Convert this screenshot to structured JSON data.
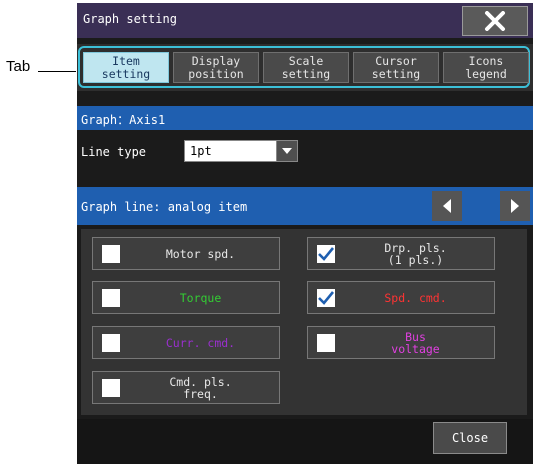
{
  "callout": {
    "label": "Tab"
  },
  "dialog": {
    "title": "Graph setting",
    "tabs": [
      {
        "label": "Item\nsetting",
        "active": true
      },
      {
        "label": "Display\nposition",
        "active": false
      },
      {
        "label": "Scale\nsetting",
        "active": false
      },
      {
        "label": "Cursor\nsetting",
        "active": false
      },
      {
        "label": "Icons\nlegend",
        "active": false
      }
    ],
    "graph_header": "Graph：Axis1",
    "line_type": {
      "label": "Line type",
      "value": "1pt"
    },
    "graph_line_header": "Graph line: analog item",
    "items": [
      {
        "label": "Motor spd.",
        "checked": false,
        "color": "#e8e8e8"
      },
      {
        "label": "Drp. pls.\n(1 pls.)",
        "checked": true,
        "color": "#e8e8e8"
      },
      {
        "label": "Torque",
        "checked": false,
        "color": "#33cc33"
      },
      {
        "label": "Spd. cmd.",
        "checked": true,
        "color": "#ff3333"
      },
      {
        "label": "Curr. cmd.",
        "checked": false,
        "color": "#9a2fcf"
      },
      {
        "label": "Bus\nvoltage",
        "checked": false,
        "color": "#e040e0"
      },
      {
        "label": "Cmd. pls.\nfreq.",
        "checked": false,
        "color": "#e8e8e8"
      }
    ],
    "close_label": "Close"
  }
}
